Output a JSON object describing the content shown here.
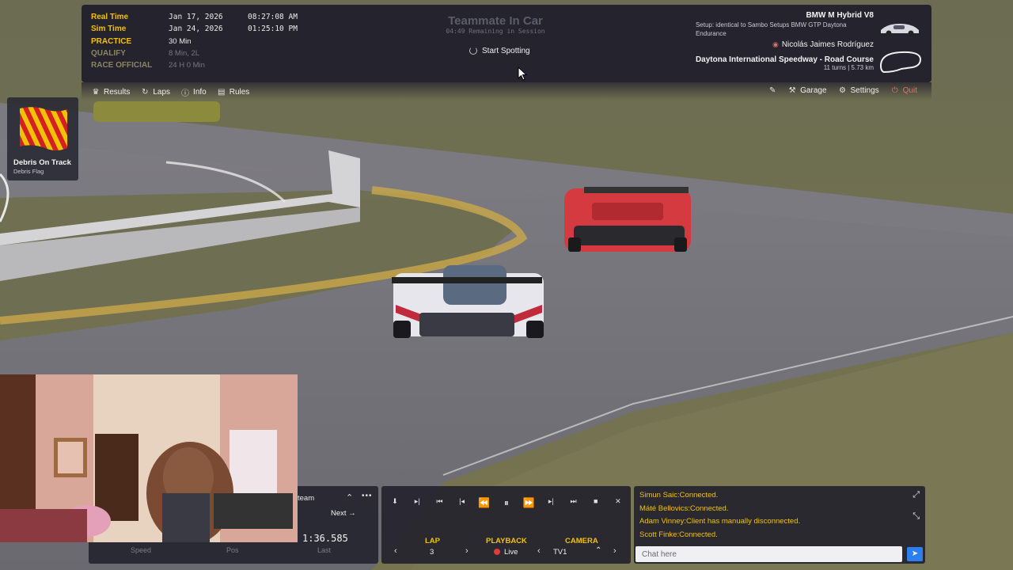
{
  "session": {
    "rows": [
      {
        "label": "Real Time",
        "val1": "Jan 17, 2026",
        "val2": "08:27:08 AM"
      },
      {
        "label": "Sim Time",
        "val1": "Jan 24, 2026",
        "val2": "01:25:10 PM"
      },
      {
        "label": "PRACTICE",
        "val1": "30 Min",
        "val2": ""
      },
      {
        "label": "QUALIFY",
        "val1": "8 Min, 2L",
        "val2": ""
      },
      {
        "label": "RACE OFFICIAL",
        "val1": "24 H 0 Min",
        "val2": ""
      }
    ],
    "title": "Teammate In Car",
    "subtitle": "04:49 Remaining in Session",
    "spot_button": "Start Spotting"
  },
  "car": {
    "name": "BMW M Hybrid V8",
    "setup": "Setup: identical to Sambo Setups BMW GTP Daytona Endurance",
    "driver": "Nicolás Jaimes Rodríguez",
    "track": "Daytona International Speedway - Road Course",
    "track_meta": "11 turns | 5.73 km"
  },
  "nav": {
    "left": [
      {
        "label": "Results",
        "icon": "trophy-icon"
      },
      {
        "label": "Laps",
        "icon": "laps-icon"
      },
      {
        "label": "Info",
        "icon": "info-icon"
      },
      {
        "label": "Rules",
        "icon": "rules-icon"
      }
    ],
    "garage": "Garage",
    "settings": "Settings",
    "quit": "Quit"
  },
  "flag": {
    "title": "Debris On Track",
    "subtitle": "Debris Flag",
    "colors": [
      "#f2c200",
      "#d42020"
    ]
  },
  "team_panel": {
    "label": "team",
    "next": "Next",
    "lap_time": "1:36.585",
    "telemetry_labels": [
      "Speed",
      "Pos",
      "Last"
    ]
  },
  "playback": {
    "lap_label": "LAP",
    "lap_value": "3",
    "playback_label": "PLAYBACK",
    "playback_value": "Live",
    "camera_label": "CAMERA",
    "camera_value": "TV1"
  },
  "chat": {
    "messages": [
      "Simun Saic:Connected.",
      "Máté Bellovics:Connected.",
      "Adam Vinney:Client has manually disconnected.",
      "Scott Finke:Connected."
    ],
    "placeholder": "Chat here"
  },
  "colors": {
    "accent_yellow": "#f2c200",
    "quit_red": "#e07070",
    "send_blue": "#2d7ff0",
    "live_red": "#e23a3a"
  }
}
